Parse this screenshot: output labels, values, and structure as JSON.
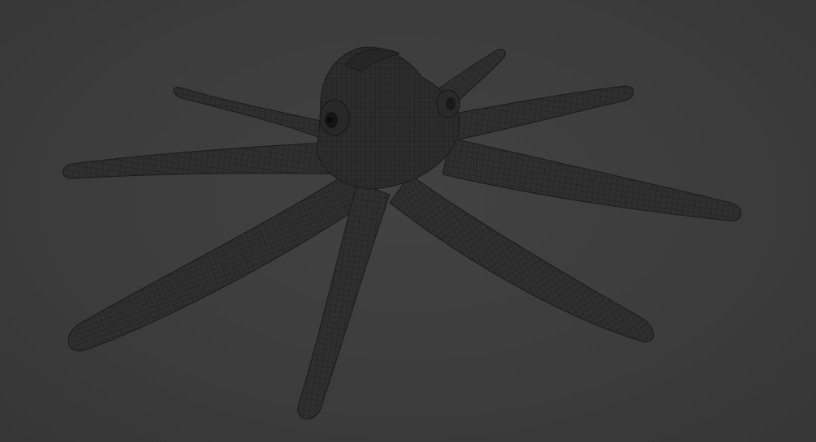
{
  "viewport": {
    "background_color": "#3d3d3d",
    "object": {
      "type": "wireframe-mesh",
      "depicts": "octopus",
      "mesh_fill_color": "#2e2e2e",
      "wire_color": "#1a1a1a",
      "tentacle_count": 8,
      "eye_count": 2
    }
  }
}
